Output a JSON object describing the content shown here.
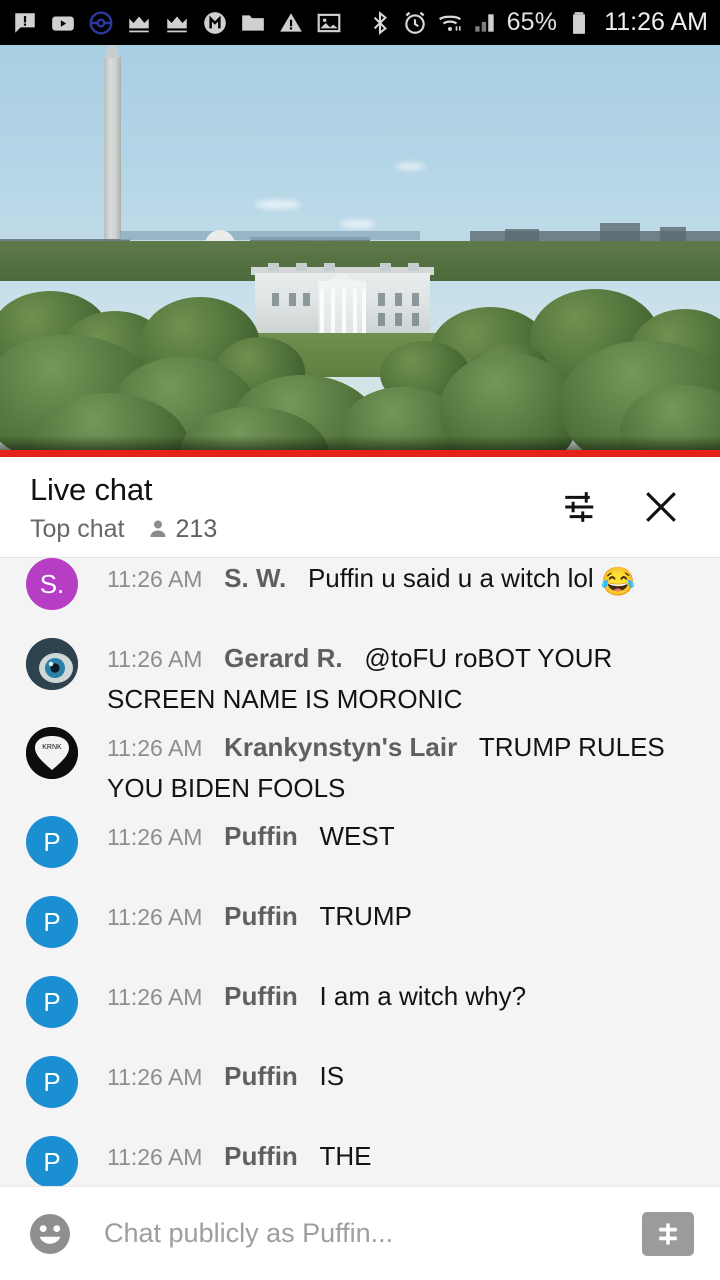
{
  "statusbar": {
    "left_icons": [
      {
        "name": "speech-bubble-alert-icon"
      },
      {
        "name": "youtube-icon"
      },
      {
        "name": "pokeball-icon"
      },
      {
        "name": "crown-icon"
      },
      {
        "name": "crown-icon"
      },
      {
        "name": "m-circle-icon"
      },
      {
        "name": "folder-icon"
      },
      {
        "name": "warning-triangle-icon"
      },
      {
        "name": "image-icon"
      }
    ],
    "bluetooth_icon": "bluetooth-icon",
    "alarm_icon": "alarm-clock-icon",
    "wifi_icon": "wifi-icon",
    "signal_icon": "cellular-signal-icon",
    "battery_percent": "65%",
    "battery_icon": "battery-icon",
    "time": "11:26 AM"
  },
  "video": {
    "name": "live-video-player",
    "scene": "White House and Washington Monument daytime skyline",
    "progress_percent": 100,
    "progress_color": "#cc0000"
  },
  "chat_header": {
    "title": "Live chat",
    "mode": "Top chat",
    "viewer_count": "213",
    "viewer_icon": "person-icon",
    "settings_icon": "chat-settings-sliders-icon",
    "close_icon": "close-x-icon"
  },
  "messages": [
    {
      "avatar_type": "letter",
      "avatar_letter": "S.",
      "avatar_color": "#b63ec4",
      "timestamp": "11:26 AM",
      "author": "S. W.",
      "text": "Puffin u said u a witch lol ",
      "emoji": "😂"
    },
    {
      "avatar_type": "eye",
      "avatar_letter": "",
      "avatar_color": "#2b3b45",
      "timestamp": "11:26 AM",
      "author": "Gerard R.",
      "text": "@toFU roBOT YOUR SCREEN NAME IS MORONIC",
      "emoji": ""
    },
    {
      "avatar_type": "pick",
      "avatar_letter": "",
      "avatar_color": "#0c0c0c",
      "timestamp": "11:26 AM",
      "author": "Krankynstyn's Lair",
      "text": "TRUMP RULES YOU BIDEN FOOLS",
      "emoji": ""
    },
    {
      "avatar_type": "letter",
      "avatar_letter": "P",
      "avatar_color": "#1b8fd1",
      "timestamp": "11:26 AM",
      "author": "Puffin",
      "text": "WEST",
      "emoji": ""
    },
    {
      "avatar_type": "letter",
      "avatar_letter": "P",
      "avatar_color": "#1b8fd1",
      "timestamp": "11:26 AM",
      "author": "Puffin",
      "text": "TRUMP",
      "emoji": ""
    },
    {
      "avatar_type": "letter",
      "avatar_letter": "P",
      "avatar_color": "#1b8fd1",
      "timestamp": "11:26 AM",
      "author": "Puffin",
      "text": "I am a witch why?",
      "emoji": ""
    },
    {
      "avatar_type": "letter",
      "avatar_letter": "P",
      "avatar_color": "#1b8fd1",
      "timestamp": "11:26 AM",
      "author": "Puffin",
      "text": "IS",
      "emoji": ""
    },
    {
      "avatar_type": "letter",
      "avatar_letter": "P",
      "avatar_color": "#1b8fd1",
      "timestamp": "11:26 AM",
      "author": "Puffin",
      "text": "THE",
      "emoji": ""
    }
  ],
  "composer": {
    "emoji_icon": "smiley-face-icon",
    "placeholder": "Chat publicly as Puffin...",
    "value": "",
    "superchat_icon": "dollar-sign-icon"
  }
}
